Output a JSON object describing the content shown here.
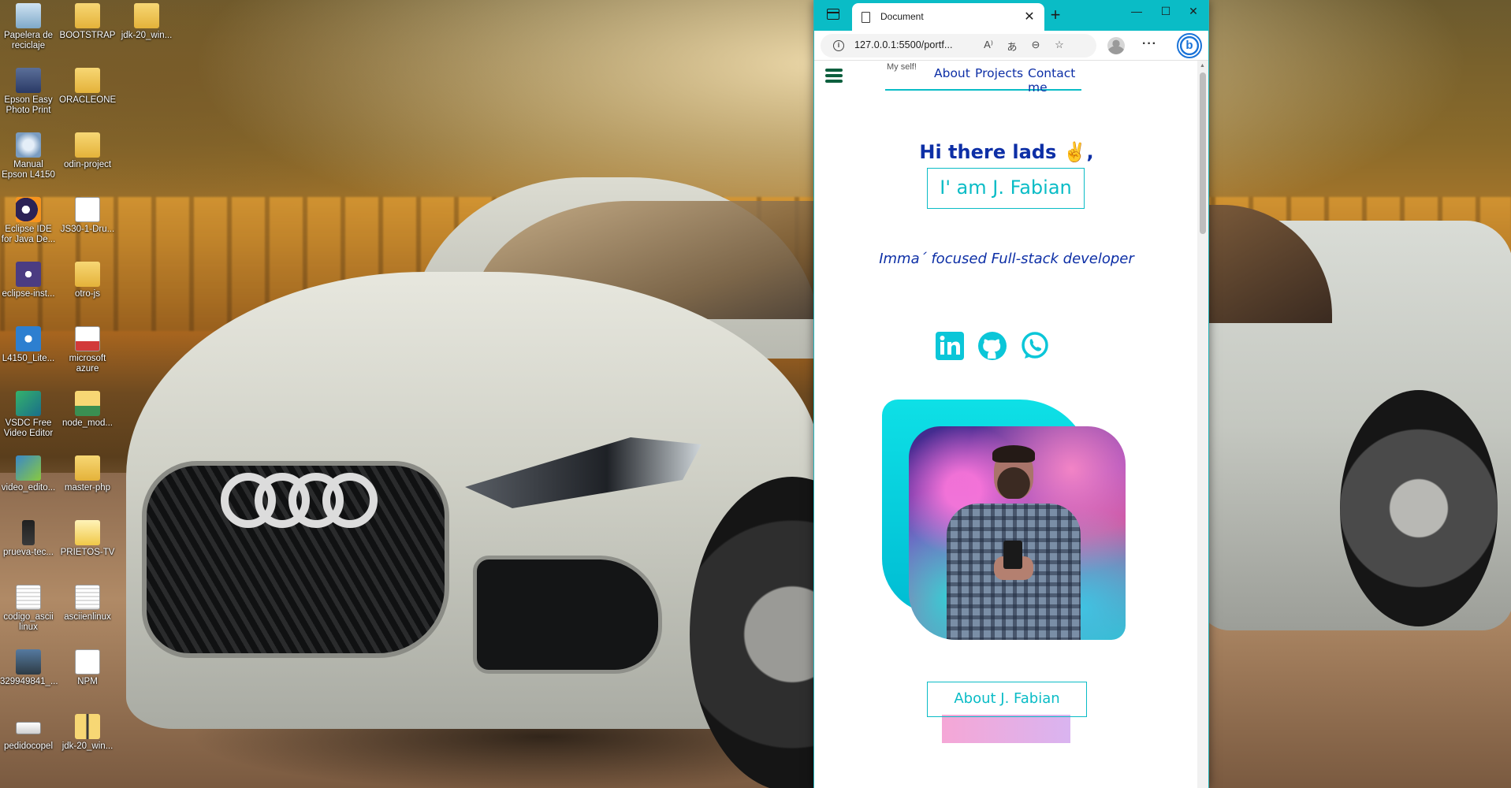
{
  "desktop": {
    "icons": [
      {
        "label": "Papelera de reciclaje",
        "glyph": "recycle-bin-icon"
      },
      {
        "label": "BOOTSTRAP",
        "glyph": "folder-icon"
      },
      {
        "label": "jdk-20_win...",
        "glyph": "folder-icon"
      },
      {
        "label": "Epson Easy Photo Print",
        "glyph": "printer-app-icon"
      },
      {
        "label": "ORACLEONE",
        "glyph": "folder-icon"
      },
      {
        "label": "Manual Epson L4150",
        "glyph": "manual-icon"
      },
      {
        "label": "odin-project",
        "glyph": "folder-icon"
      },
      {
        "label": "Eclipse IDE for Java De...",
        "glyph": "eclipse-icon"
      },
      {
        "label": "JS30-1-Dru...",
        "glyph": "document-icon"
      },
      {
        "label": "eclipse-inst...",
        "glyph": "installer-icon"
      },
      {
        "label": "otro-js",
        "glyph": "folder-icon"
      },
      {
        "label": "L4150_Lite...",
        "glyph": "download-icon"
      },
      {
        "label": "microsoft azure",
        "glyph": "pdf-icon"
      },
      {
        "label": "VSDC Free Video Editor",
        "glyph": "video-editor-icon"
      },
      {
        "label": "node_mod...",
        "glyph": "folder-icon"
      },
      {
        "label": "video_edito...",
        "glyph": "video-file-icon"
      },
      {
        "label": "master-php",
        "glyph": "folder-icon"
      },
      {
        "label": "prueva-tec...",
        "glyph": "terminal-icon"
      },
      {
        "label": "PRIETOS-TV",
        "glyph": "folder-icon"
      },
      {
        "label": "codigo_ascii linux",
        "glyph": "text-grid-icon"
      },
      {
        "label": "asciienlinux",
        "glyph": "text-grid-icon"
      },
      {
        "label": "329949841_...",
        "glyph": "photo-icon"
      },
      {
        "label": "NPM",
        "glyph": "document-icon"
      },
      {
        "label": "pedidocopel",
        "glyph": "drive-icon"
      },
      {
        "label": "jdk-20_win...",
        "glyph": "zip-icon"
      }
    ]
  },
  "browser": {
    "tab_title": "Document",
    "tab_close": "✕",
    "new_tab": "+",
    "minimize": "—",
    "maximize": "☐",
    "close": "✕",
    "url": "127.0.0.1:5500/portf...",
    "read_aloud": "A⁾",
    "translate": "あ",
    "zoom": "⊖",
    "favorites": "☆",
    "more": "···",
    "copilot": "b"
  },
  "page": {
    "nav": {
      "logo_alt": "My self!",
      "links": [
        "About",
        "Projects",
        "Contact me"
      ]
    },
    "hero": {
      "greeting": "Hi there lads ✌️,",
      "name": "I' am J. Fabian",
      "tagline": "Imma´ focused Full-stack developer"
    },
    "social": [
      "linkedin-icon",
      "github-icon",
      "whatsapp-icon"
    ],
    "about_button": "About J. Fabian"
  },
  "colors": {
    "accent_cyan": "#0abcc6",
    "primary_blue": "#0d2fa6",
    "hamburger_green": "#0d5f3e",
    "about_shadow": "#f5a7d6"
  }
}
